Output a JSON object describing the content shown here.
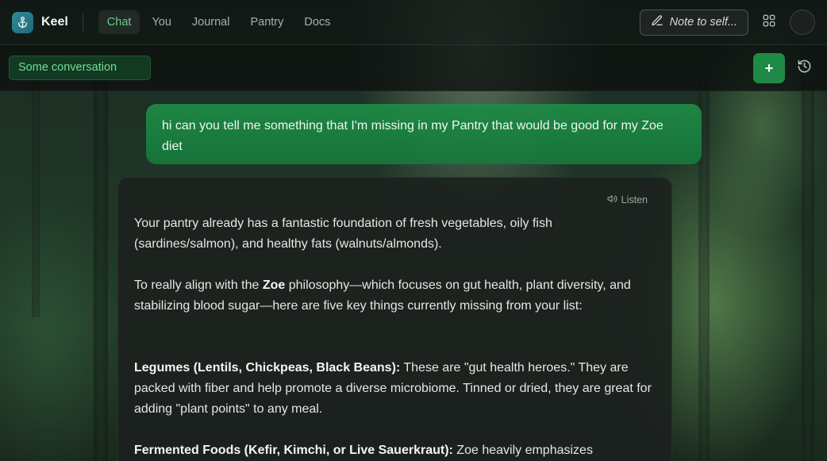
{
  "app": {
    "name": "Keel"
  },
  "nav": {
    "tabs": [
      {
        "label": "Chat",
        "active": true
      },
      {
        "label": "You"
      },
      {
        "label": "Journal"
      },
      {
        "label": "Pantry"
      },
      {
        "label": "Docs"
      }
    ]
  },
  "header": {
    "note_label": "Note to self...",
    "note_icon": "pencil-icon",
    "grid_icon": "grid-icon"
  },
  "subbar": {
    "conversation_title": "Some conversation",
    "new_label": "+",
    "history_icon": "history-icon"
  },
  "chat": {
    "user_message": "hi can you tell me something that I'm missing in my Pantry that would be good for my Zoe diet",
    "assistant": {
      "listen_label": "Listen",
      "p1": "Your pantry already has a fantastic foundation of fresh vegetables, oily fish (sardines/salmon), and healthy fats (walnuts/almonds).",
      "p2_a": "To really align with the ",
      "p2_bold": "Zoe",
      "p2_b": " philosophy—which focuses on gut health, plant diversity, and stabilizing blood sugar—here are five key things currently missing from your list:",
      "item1_bold": "Legumes (Lentils, Chickpeas, Black Beans):",
      "item1_text": " These are \"gut health heroes.\" They are packed with fiber and help promote a diverse microbiome. Tinned or dried, they are great for adding \"plant points\" to any meal.",
      "item2_bold": "Fermented Foods (Kefir, Kimchi, or Live Sauerkraut):",
      "item2_text": " Zoe heavily emphasizes"
    }
  },
  "colors": {
    "accent": "#1f8a46",
    "active_tab": "#5fd08a"
  }
}
